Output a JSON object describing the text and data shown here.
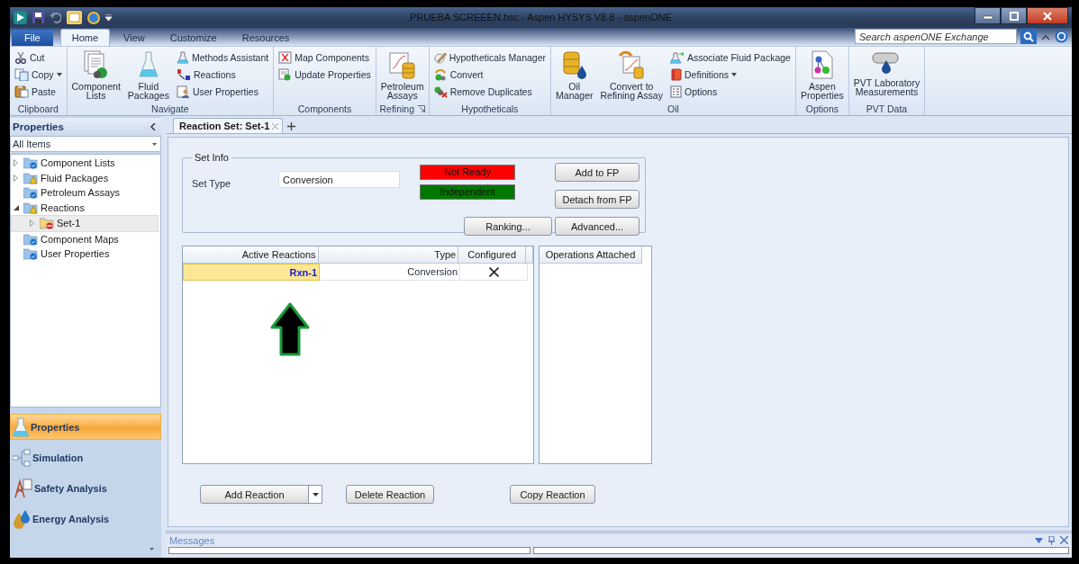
{
  "window": {
    "title": "PRUEBA SCREEEN.hsc - Aspen HYSYS V8.8 - aspenONE"
  },
  "ribbon": {
    "tabs": [
      {
        "label": "File",
        "kind": "file",
        "selected": false
      },
      {
        "label": "Home",
        "kind": "tab",
        "selected": true
      },
      {
        "label": "View",
        "kind": "tab",
        "selected": false
      },
      {
        "label": "Customize",
        "kind": "tab",
        "selected": false
      },
      {
        "label": "Resources",
        "kind": "tab",
        "selected": false
      }
    ],
    "search": {
      "placeholder": "Search aspenONE Exchange"
    },
    "groups": [
      {
        "label": "Clipboard",
        "columns": [
          [
            {
              "label": "Cut",
              "kind": "small"
            },
            {
              "label": "Copy",
              "kind": "small",
              "dropdown": true
            },
            {
              "label": "Paste",
              "kind": "small"
            }
          ]
        ]
      },
      {
        "label": "Navigate",
        "columns": [
          [
            {
              "label": "Component\nLists",
              "kind": "large"
            }
          ],
          [
            {
              "label": "Fluid\nPackages",
              "kind": "large"
            }
          ],
          [
            {
              "label": "Methods Assistant",
              "kind": "small"
            },
            {
              "label": "Reactions",
              "kind": "small"
            },
            {
              "label": "User Properties",
              "kind": "small"
            }
          ]
        ]
      },
      {
        "label": "Components",
        "columns": [
          [
            {
              "label": "Map Components",
              "kind": "small"
            },
            {
              "label": "Update Properties",
              "kind": "small"
            }
          ]
        ]
      },
      {
        "label": "Refining",
        "launcher": true,
        "columns": [
          [
            {
              "label": "Petroleum\nAssays",
              "kind": "large"
            }
          ]
        ]
      },
      {
        "label": "Hypotheticals",
        "columns": [
          [
            {
              "label": "Hypotheticals Manager",
              "kind": "small"
            },
            {
              "label": "Convert",
              "kind": "small"
            },
            {
              "label": "Remove Duplicates",
              "kind": "small"
            }
          ]
        ]
      },
      {
        "label": "Oil",
        "columns": [
          [
            {
              "label": "Oil\nManager",
              "kind": "large"
            }
          ],
          [
            {
              "label": "Convert to\nRefining Assay",
              "kind": "large"
            }
          ],
          [
            {
              "label": "Associate Fluid Package",
              "kind": "small"
            },
            {
              "label": "Definitions",
              "kind": "small",
              "dropdown": true
            },
            {
              "label": "Options",
              "kind": "small"
            }
          ]
        ]
      },
      {
        "label": "Options",
        "columns": [
          [
            {
              "label": "Aspen\nProperties",
              "kind": "large"
            }
          ]
        ]
      },
      {
        "label": "PVT Data",
        "columns": [
          [
            {
              "label": "PVT Laboratory\nMeasurements",
              "kind": "large"
            }
          ]
        ]
      }
    ]
  },
  "sidebar": {
    "title": "Properties",
    "filter": "All Items",
    "tree": [
      {
        "label": "Component Lists",
        "kind": "ok",
        "expanded": false,
        "selected": false
      },
      {
        "label": "Fluid Packages",
        "kind": "warning",
        "expanded": false,
        "selected": false
      },
      {
        "label": "Petroleum Assays",
        "kind": "ok",
        "selected": false
      },
      {
        "label": "Reactions",
        "kind": "warning",
        "expanded": true,
        "selected": false,
        "children": [
          {
            "label": "Set-1",
            "kind": "error",
            "expanded": false,
            "selected": true
          }
        ]
      },
      {
        "label": "Component Maps",
        "kind": "ok",
        "selected": false
      },
      {
        "label": "User Properties",
        "kind": "ok",
        "selected": false
      }
    ],
    "nav": [
      {
        "label": "Properties",
        "selected": true
      },
      {
        "label": "Simulation",
        "selected": false
      },
      {
        "label": "Safety Analysis",
        "selected": false
      },
      {
        "label": "Energy Analysis",
        "selected": false
      }
    ]
  },
  "document_tab": {
    "title": "Reaction Set: Set-1"
  },
  "set_info": {
    "title": "Set Info",
    "set_type_label": "Set Type",
    "set_type": "Conversion",
    "statuses": [
      {
        "label": "Not Ready",
        "color": "#ff0000"
      },
      {
        "label": "Independent",
        "color": "#007700"
      }
    ],
    "buttons": [
      "Add to FP",
      "Detach from FP",
      "Ranking...",
      "Advanced..."
    ]
  },
  "reactions_table": {
    "columns": [
      "Active Reactions",
      "Type",
      "Configured"
    ],
    "rows": [
      {
        "name": "Rxn-1",
        "type": "Conversion",
        "configured": false,
        "selected": true
      }
    ]
  },
  "operations": {
    "title": "Operations Attached"
  },
  "actions": [
    {
      "label": "Add Reaction",
      "dropdown": true
    },
    {
      "label": "Delete Reaction"
    },
    {
      "label": "Copy Reaction"
    }
  ],
  "messages": {
    "title": "Messages"
  }
}
